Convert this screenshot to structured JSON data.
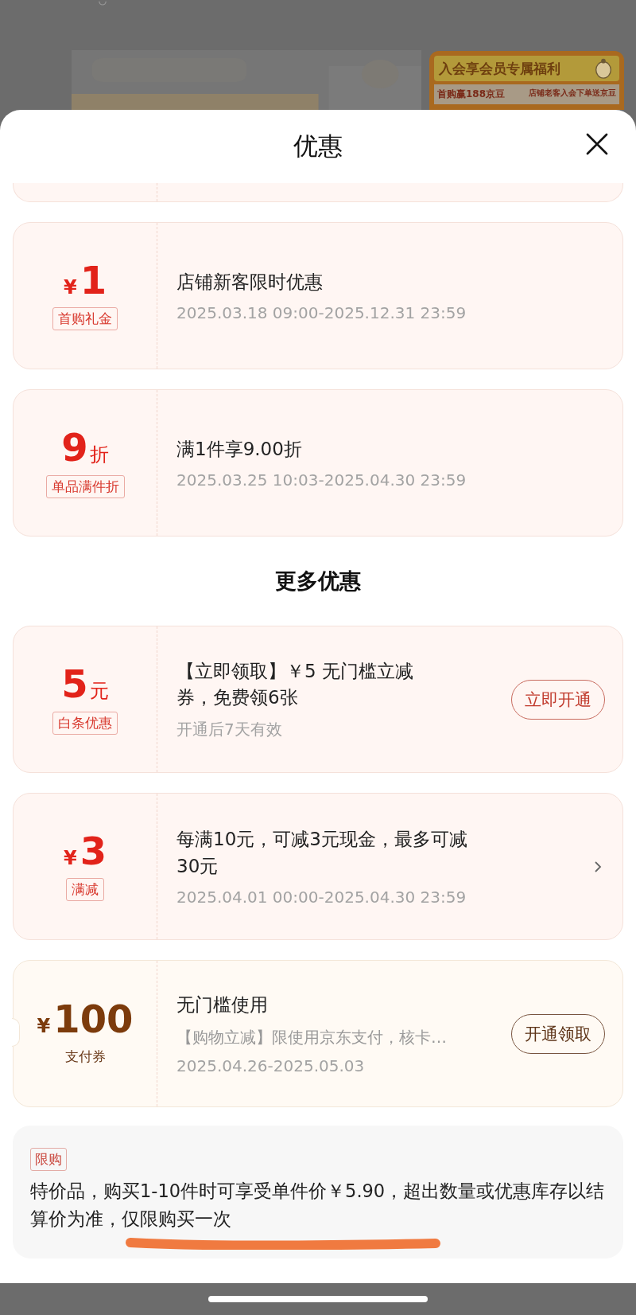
{
  "background": {
    "banner_title": "入会享会员专属福利",
    "banner_items": [
      "首购赢188京豆",
      "店铺老客入会下单送京豆"
    ]
  },
  "sheet": {
    "title": "优惠"
  },
  "coupons": [
    {
      "kind": "red",
      "prefix": "¥",
      "amount": "1",
      "tag": "首购礼金",
      "title": "店铺新客限时优惠",
      "date": "2025.03.18 09:00-2025.12.31 23:59"
    },
    {
      "kind": "red",
      "amount": "9",
      "suffix": "折",
      "tag": "单品满件折",
      "title": "满1件享9.00折",
      "date": "2025.03.25 10:03-2025.04.30 23:59"
    }
  ],
  "more_title": "更多优惠",
  "more_coupons": [
    {
      "kind": "red",
      "amount": "5",
      "suffix": "元",
      "tag": "白条优惠",
      "title": "【立即领取】￥5 无门槛立减券，免费领6张",
      "date": "开通后7天有效",
      "action": {
        "kind": "button",
        "label": "立即开通"
      }
    },
    {
      "kind": "red",
      "prefix": "¥",
      "amount": "3",
      "tag": "满减",
      "title": "每满10元，可减3元现金，最多可减30元",
      "date": "2025.04.01 00:00-2025.04.30 23:59",
      "action": {
        "kind": "chevron"
      }
    },
    {
      "kind": "gold",
      "prefix": "¥",
      "amount": "100",
      "tag": "支付券",
      "title": "无门槛使用",
      "desc": "【购物立减】限使用京东支付，核卡…",
      "date": "2025.04.26-2025.05.03",
      "action": {
        "kind": "button",
        "label": "开通领取"
      }
    }
  ],
  "notice": {
    "tag": "限购",
    "text": "特价品，购买1-10件时可享受单件价￥5.90，超出数量或优惠库存以结算价为准，仅限购买一次"
  }
}
